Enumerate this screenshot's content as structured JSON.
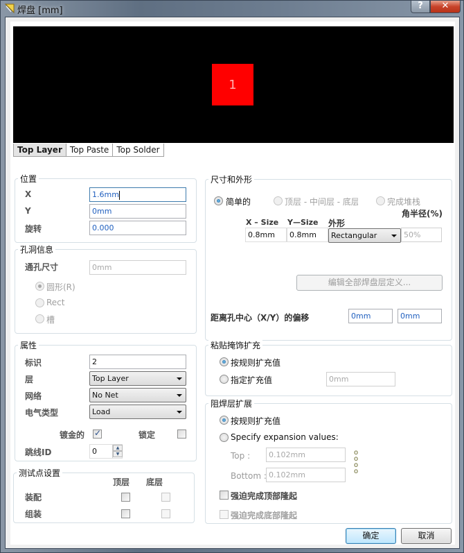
{
  "window": {
    "title": "焊盘 [mm]",
    "help_label": "?",
    "close_label": "✕"
  },
  "preview": {
    "pad_number": "1",
    "pad_color": "#ff0000",
    "tabs": [
      {
        "label": "Top Layer",
        "active": true
      },
      {
        "label": "Top Paste",
        "active": false
      },
      {
        "label": "Top Solder",
        "active": false
      }
    ]
  },
  "location": {
    "title": "位置",
    "x_label": "X",
    "x_value": "1.6mm",
    "y_label": "Y",
    "y_value": "0mm",
    "rotation_label": "旋转",
    "rotation_value": "0.000"
  },
  "hole": {
    "title": "孔洞信息",
    "size_label": "通孔尺寸",
    "size_value": "0mm",
    "options": [
      {
        "label": "圆形(R)",
        "selected": true
      },
      {
        "label": "Rect",
        "selected": false
      },
      {
        "label": "槽",
        "selected": false
      }
    ]
  },
  "properties": {
    "title": "属性",
    "designator_label": "标识",
    "designator_value": "2",
    "layer_label": "层",
    "layer_value": "Top Layer",
    "net_label": "网络",
    "net_value": "No Net",
    "electrical_label": "电气类型",
    "electrical_value": "Load",
    "plated_label": "镀金的",
    "plated_checked": true,
    "locked_label": "锁定",
    "locked_checked": false,
    "jumper_label": "跳线ID",
    "jumper_value": "0"
  },
  "testpoint": {
    "title": "测试点设置",
    "col_top": "顶层",
    "col_bottom": "底层",
    "row_fab": "装配",
    "row_assy": "组装"
  },
  "size_shape": {
    "title": "尺寸和外形",
    "modes": [
      {
        "label": "简单的",
        "selected": true,
        "enabled": true
      },
      {
        "label": "顶层 - 中间层 - 底层",
        "selected": false,
        "enabled": false
      },
      {
        "label": "完成堆栈",
        "selected": false,
        "enabled": false
      }
    ],
    "corner_label": "角半径(%)",
    "xsize_header": "X – Size",
    "ysize_header": "Y—Size",
    "shape_header": "外形",
    "xsize_value": "0.8mm",
    "ysize_value": "0.8mm",
    "shape_value": "Rectangular",
    "corner_value": "50%",
    "edit_layers_label": "编辑全部焊盘层定义...",
    "offset_label": "距离孔中心（X/Y）的偏移",
    "offset_x": "0mm",
    "offset_y": "0mm"
  },
  "paste_mask": {
    "title": "粘贴掩饰扩充",
    "rule_label": "按规则扩充值",
    "specify_label": "指定扩充值",
    "specify_value": "0mm",
    "selected": "rule"
  },
  "solder_mask": {
    "title": "阻焊层扩展",
    "rule_label": "按规则扩充值",
    "specify_label": "Specify expansion values:",
    "top_label": "Top :",
    "top_value": "0.102mm",
    "bottom_label": "Bottom :",
    "bottom_value": "0.102mm",
    "force_top_label": "强迫完成顶部隆起",
    "force_bottom_label": "强迫完成底部隆起",
    "selected": "rule"
  },
  "footer": {
    "ok_label": "确定",
    "cancel_label": "取消"
  }
}
